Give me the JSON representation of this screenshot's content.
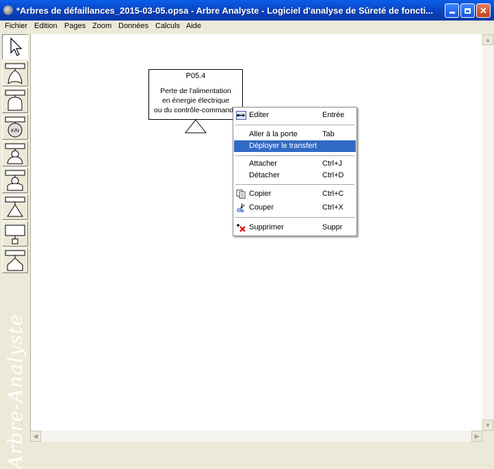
{
  "window": {
    "title": "*Arbres de défaillances_2015-03-05.opsa - Arbre Analyste - Logiciel d'analyse de Sûreté de foncti..."
  },
  "menubar": {
    "items": [
      "Fichier",
      "Edition",
      "Pages",
      "Zoom",
      "Données",
      "Calculs",
      "Aide"
    ]
  },
  "toolbox": {
    "watermark": "Arbre-Analyste",
    "tools": [
      "select-arrow-icon",
      "or-gate-icon",
      "and-gate-icon",
      "k-out-of-n-gate-icon",
      "basic-event-icon",
      "house-event-icon",
      "transfer-gate-icon",
      "undeveloped-event-icon",
      "transfer-in-icon"
    ],
    "kn_label": "K/N"
  },
  "gate": {
    "id": "P05.4",
    "description_lines": [
      "Perte de l'alimentation",
      "en énergie électrique",
      "ou du contrôle-commande"
    ]
  },
  "context_menu": {
    "highlighted_index": 2,
    "items": [
      {
        "label": "Editer",
        "shortcut": "Entrée",
        "icon": "edit-icon"
      },
      {
        "label": "Aller à la porte",
        "shortcut": "Tab",
        "icon": ""
      },
      {
        "label": "Déployer le transfert",
        "shortcut": "",
        "icon": ""
      },
      {
        "label": "Attacher",
        "shortcut": "Ctrl+J",
        "icon": ""
      },
      {
        "label": "Détacher",
        "shortcut": "Ctrl+D",
        "icon": ""
      },
      {
        "label": "Copier",
        "shortcut": "Ctrl+C",
        "icon": "copy-icon"
      },
      {
        "label": "Couper",
        "shortcut": "Ctrl+X",
        "icon": "cut-icon"
      },
      {
        "label": "Supprimer",
        "shortcut": "Suppr",
        "icon": "delete-icon"
      }
    ]
  },
  "colors": {
    "titlebar": "#0842c0",
    "highlight": "#316ac5",
    "canvas": "#ffffff",
    "chrome": "#ece9d8"
  }
}
